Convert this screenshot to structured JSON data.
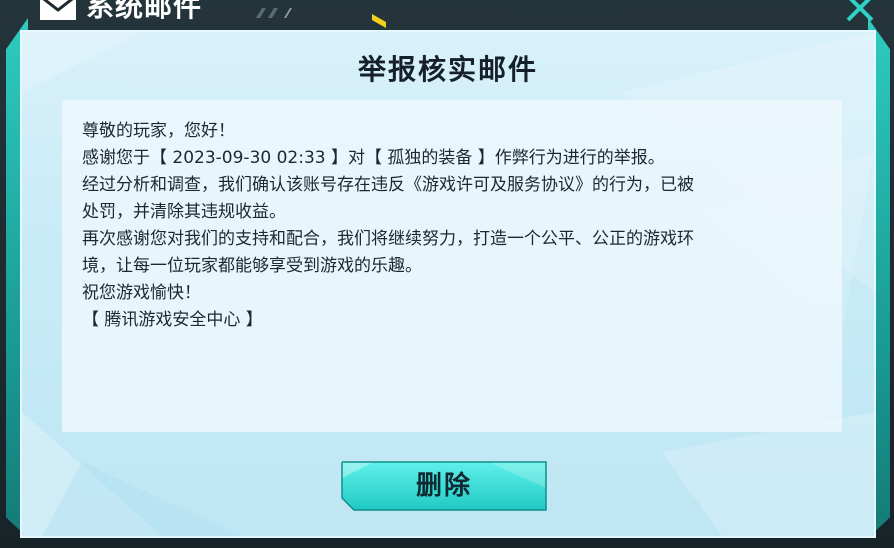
{
  "header": {
    "title": "系统邮件"
  },
  "mail": {
    "title": "举报核实邮件",
    "lines": [
      "尊敬的玩家，您好！",
      "感谢您于【 2023-09-30 02:33 】对【 孤独的装备 】作弊行为进行的举报。",
      "经过分析和调查，我们确认该账号存在违反《游戏许可及服务协议》的行为，已被",
      "处罚，并清除其违规收益。",
      "再次感谢您对我们的支持和配合，我们将继续努力，打造一个公平、公正的游戏环",
      "境，让每一位玩家都能够享受到游戏的乐趣。",
      "祝您游戏愉快！",
      "【 腾讯游戏安全中心 】"
    ]
  },
  "actions": {
    "delete_label": "删除"
  },
  "icons": {
    "mail": "mail-icon",
    "close": "close-icon"
  },
  "colors": {
    "accent_teal": "#2fd3c6",
    "accent_yellow": "#f2d11a",
    "panel_bg": "#c9ebf7"
  }
}
